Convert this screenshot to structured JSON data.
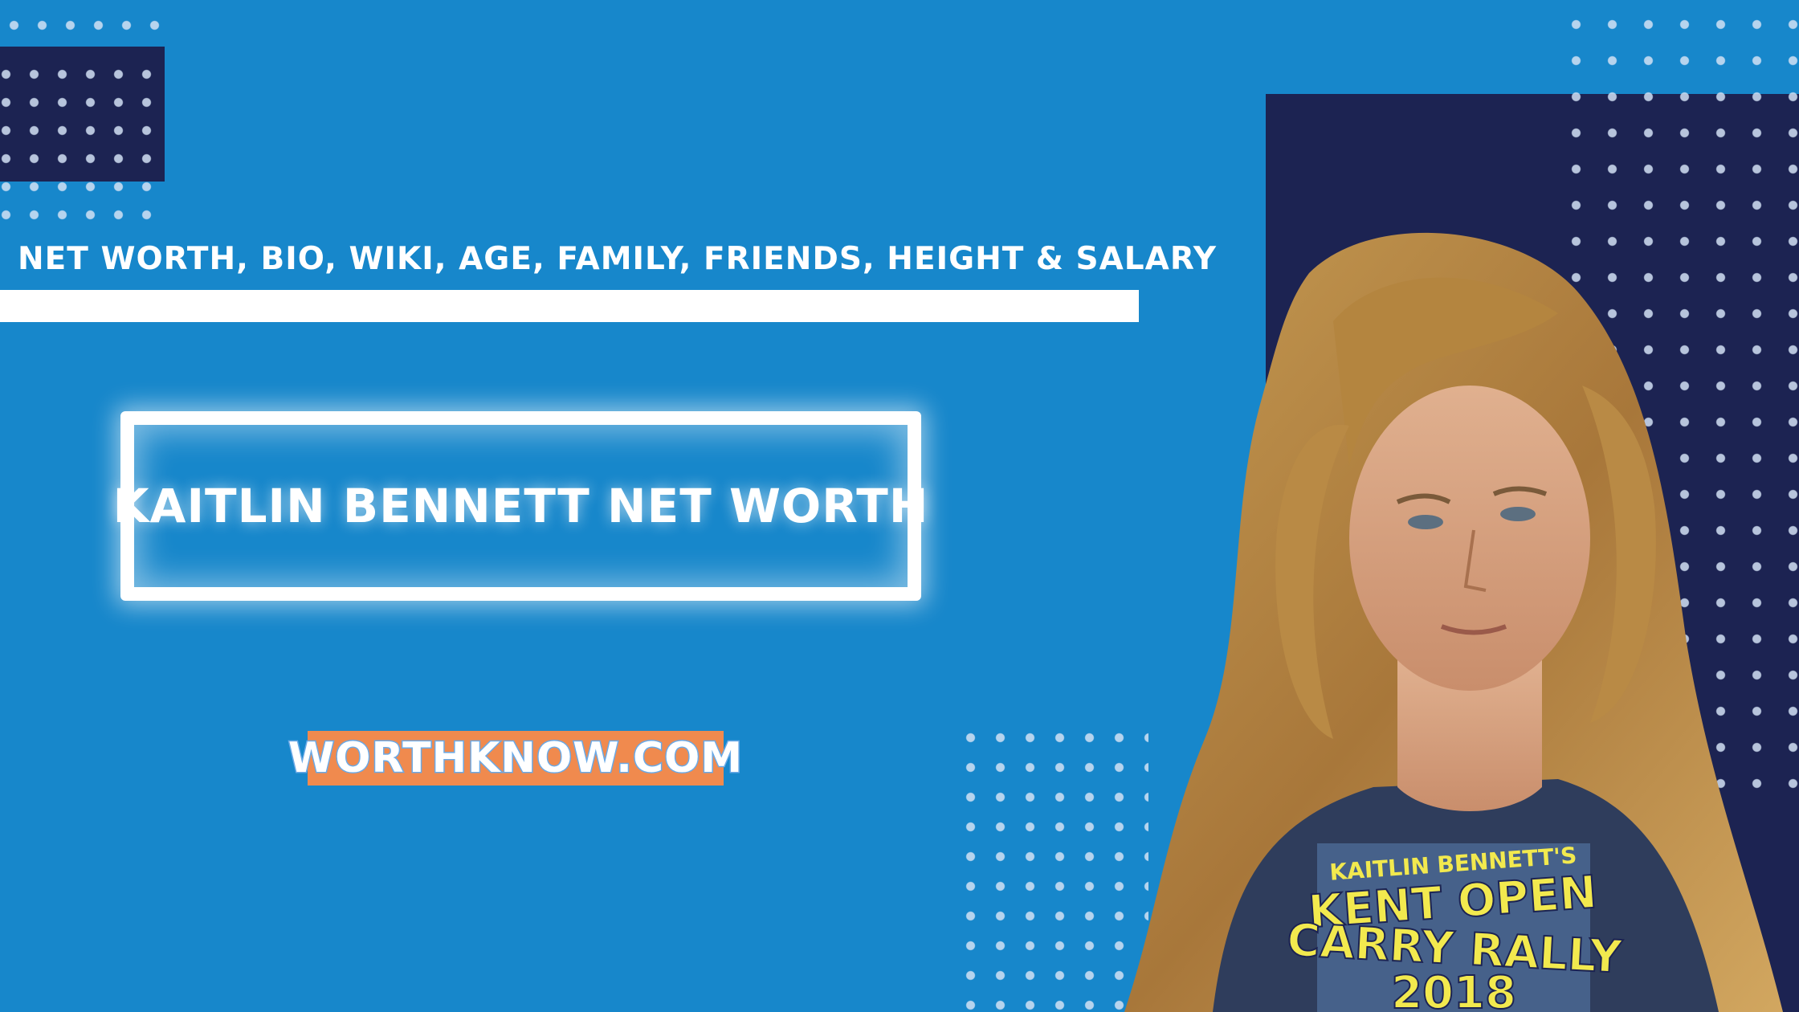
{
  "colors": {
    "background": "#1787cb",
    "navy": "#1c2352",
    "accent": "#f08a4e",
    "white": "#ffffff"
  },
  "subtitle": "NET WORTH, BIO, WIKI, AGE, FAMILY, FRIENDS, HEIGHT & SALARY",
  "title": "KAITLIN BENNETT NET WORTH",
  "brand": "WORTHKNOW.COM",
  "photo": {
    "shirt_line1": "KAITLIN BENNETT'S",
    "shirt_line2": "KENT OPEN",
    "shirt_line3": "CARRY RALLY",
    "shirt_line4": "2018"
  }
}
